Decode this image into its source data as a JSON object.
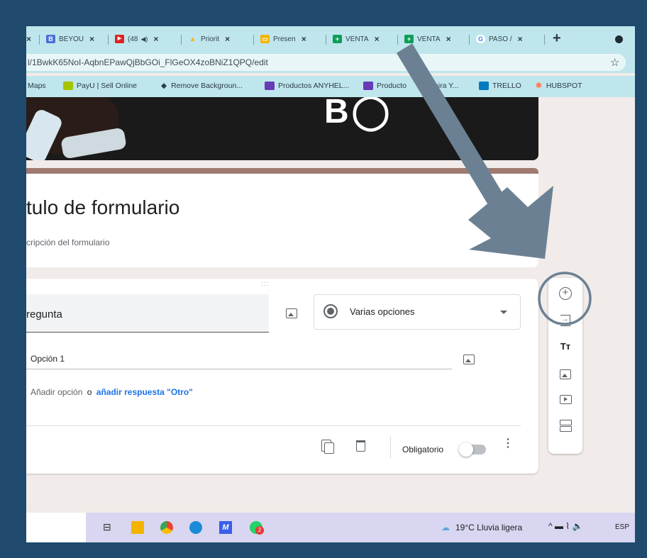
{
  "browser": {
    "tabs": [
      {
        "label": "BEYOU",
        "favicon_color": "#4a6fd8",
        "glyph": "B"
      },
      {
        "label": "(48",
        "favicon_color": "#e02020",
        "glyph": "▶"
      },
      {
        "label": "Priorit",
        "favicon_color": "#f3b300",
        "glyph": "▲"
      },
      {
        "label": "Presen",
        "favicon_color": "#f4b400",
        "glyph": "▭"
      },
      {
        "label": "VENTA",
        "favicon_color": "#0f9d58",
        "glyph": "+"
      },
      {
        "label": "VENTA",
        "favicon_color": "#0f9d58",
        "glyph": "+"
      },
      {
        "label": "PASO /",
        "favicon_color": "#4285f4",
        "glyph": "G"
      }
    ],
    "close_glyph": "×",
    "new_tab_glyph": "+",
    "address": "l/1BwkK65NoI-AqbnEPawQjBbGOi_FlGeOX4zoBNiZ1QPQ/edit",
    "star_glyph": "☆",
    "bookmarks": [
      {
        "label": "Maps",
        "icon_color": ""
      },
      {
        "label": "PayU | Sell Online",
        "icon_color": "#a4c400"
      },
      {
        "label": "Remove Backgroun...",
        "icon_color": "#333"
      },
      {
        "label": "Productos ANYHEL...",
        "icon_color": "#673ab7"
      },
      {
        "label": "Producto",
        "icon_color": "#673ab7"
      },
      {
        "label": "mira Y...",
        "icon_color": ""
      },
      {
        "label": "TRELLO",
        "icon_color": "#0079bf"
      },
      {
        "label": "HUBSPOT",
        "icon_color": "#ff7a59"
      }
    ]
  },
  "form": {
    "title": "tulo de formulario",
    "description": "cripción del formulario",
    "question": {
      "drag_handle": ":::",
      "title": "regunta",
      "type": "Varias opciones",
      "options": [
        "Opción 1"
      ],
      "add_option": "Añadir opción",
      "or": "o",
      "add_other": "añadir respuesta \"Otro\"",
      "required_label": "Obligatorio",
      "more_glyph": "⋮"
    }
  },
  "sidebar": {
    "add_glyph": "+",
    "import_glyph": "→",
    "title_glyph": "Tт"
  },
  "taskbar": {
    "weather": "19°C  Lluvia ligera",
    "tray": "^  ▬  ⌇  🔈",
    "lang": "ESP",
    "notification_badge": "2"
  },
  "overlay": {
    "arrow_color": "#6b8193",
    "circle_color": "#6b8193"
  }
}
